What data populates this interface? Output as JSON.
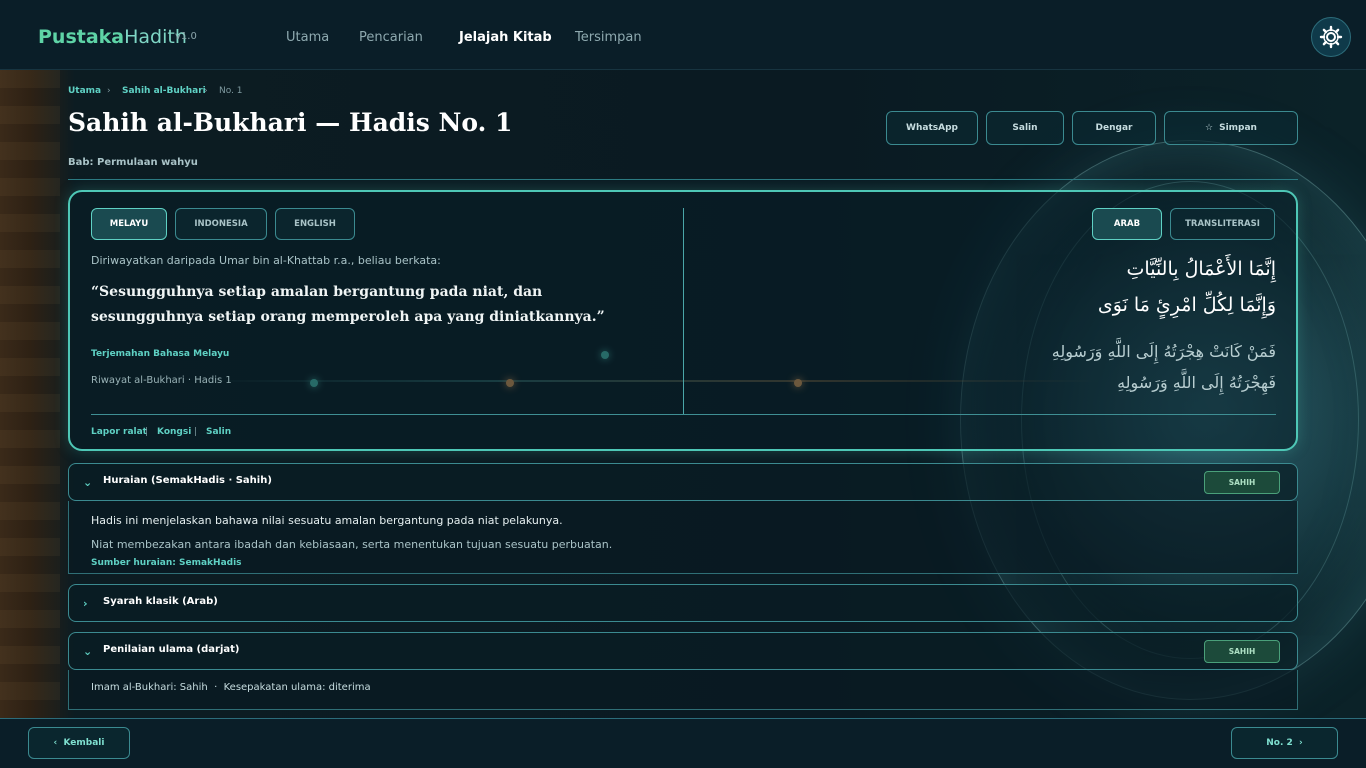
{
  "app": {
    "brand_part1": "Pustaka",
    "brand_part2": "Hadith",
    "version": "v1.0"
  },
  "nav": {
    "items": [
      {
        "label": "Utama"
      },
      {
        "label": "Pencarian"
      },
      {
        "label": "Jelajah Kitab",
        "active": true
      },
      {
        "label": "Tersimpan"
      }
    ],
    "settings_icon": "gear-icon"
  },
  "breadcrumb": {
    "items": [
      "Utama",
      "Sahih al-Bukhari",
      "No. 1"
    ],
    "separator": "›"
  },
  "page": {
    "title": "Sahih al-Bukhari — Hadis No. 1",
    "bab": "Bab: Permulaan wahyu"
  },
  "actions": {
    "whatsapp": "WhatsApp",
    "copy": "Salin",
    "listen": "Dengar",
    "save_icon": "☆",
    "save": "Simpan"
  },
  "translation": {
    "tabs": [
      "MELAYU",
      "INDONESIA",
      "ENGLISH"
    ],
    "active_tab": "MELAYU",
    "narrator": "Diriwayatkan daripada Umar bin al-Khattab r.a., beliau berkata:",
    "quote": "“Sesungguhnya setiap amalan bergantung pada niat, dan sesungguhnya setiap orang memperoleh apa yang diniatkannya.”",
    "label": "Terjemahan Bahasa Melayu",
    "source": "Riwayat al-Bukhari · Hadis 1"
  },
  "arabic": {
    "tabs": [
      "ARAB",
      "TRANSLITERASI"
    ],
    "active_tab": "ARAB",
    "line1": "إِنَّمَا الأَعْمَالُ بِالنِّيَّاتِ",
    "line2": "وَإِنَّمَا لِكُلِّ امْرِئٍ مَا نَوَى",
    "line3": "فَمَنْ كَانَتْ هِجْرَتُهُ إِلَى اللَّهِ وَرَسُولِهِ",
    "line4": "فَهِجْرَتُهُ إِلَى اللَّهِ وَرَسُولِهِ"
  },
  "card_footer": {
    "report": "Lapor ralat",
    "share": "Kongsi",
    "copy": "Salin",
    "separator": "|"
  },
  "sections": {
    "huraian": {
      "title": "Huraian (SemakHadis · Sahih)",
      "badge": "SAHIH",
      "text1": "Hadis ini menjelaskan bahawa nilai sesuatu amalan bergantung pada niat pelakunya.",
      "text2": "Niat membezakan antara ibadah dan kebiasaan, serta menentukan tujuan sesuatu perbuatan.",
      "source": "Sumber huraian: SemakHadis"
    },
    "syarah": {
      "title": "Syarah klasik (Arab)"
    },
    "penilaian": {
      "title": "Penilaian ulama (darjat)",
      "badge": "SAHIH",
      "text": "Imam al-Bukhari: Sahih  ·  Kesepakatan ulama: diterima"
    }
  },
  "footer": {
    "prev": "‹  Kembali",
    "next": "No. 2  ›"
  },
  "colors": {
    "accent": "#5fd1c4",
    "brand": "#5ed3a6",
    "background": "#06141c"
  }
}
